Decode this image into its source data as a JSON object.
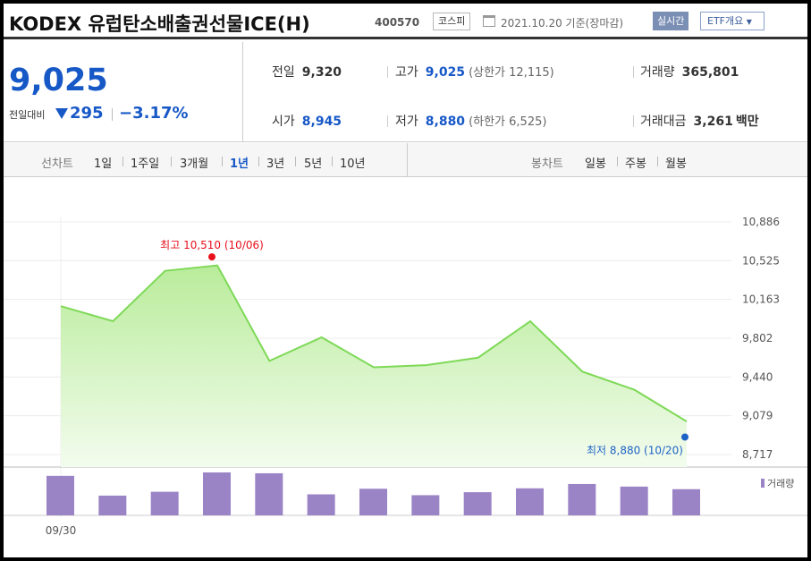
{
  "header": {
    "title": "KODEX 유럽탄소배출권선물ICE(H)",
    "code": "400570",
    "market": "코스피",
    "date": "2021.10.20",
    "date_suffix": "기준(장마감)",
    "realtime_label": "실시간",
    "etf_label": "ETF개요"
  },
  "quote": {
    "price": "9,025",
    "compare_label": "전일대비",
    "change": "295",
    "change_rate": "−3.17%",
    "prev_close": {
      "label": "전일",
      "value": "9,320"
    },
    "open": {
      "label": "시가",
      "value": "8,945"
    },
    "high": {
      "label": "고가",
      "value": "9,025",
      "sub": "(상한가 12,115)"
    },
    "low": {
      "label": "저가",
      "value": "8,880",
      "sub": "(하한가 6,525)"
    },
    "volume": {
      "label": "거래량",
      "value": "365,801"
    },
    "amount": {
      "label": "거래대금",
      "value": "3,261",
      "unit": "백만"
    }
  },
  "tabs": {
    "line_label": "선차트",
    "periods": [
      "1일",
      "1주일",
      "3개월",
      "1년",
      "3년",
      "5년",
      "10년"
    ],
    "selected_period": "1년",
    "candle_label": "봉차트",
    "candles": [
      "일봉",
      "주봉",
      "월봉"
    ]
  },
  "colors": {
    "line": "#7ed957",
    "area_top": "#b9ec9b",
    "area_bottom": "#f3fcee",
    "high_marker": "#e8101a",
    "low_marker": "#1e63c6",
    "volume_bar": "#9b84c6",
    "accent": "#1758c7"
  },
  "chart_data": {
    "type": "area",
    "x_label_first": "09/30",
    "price": [
      10100,
      9960,
      10430,
      10480,
      9590,
      9810,
      9530,
      9550,
      9620,
      9960,
      9490,
      9320,
      9025
    ],
    "volume_relative": [
      0.92,
      0.46,
      0.55,
      1.0,
      0.98,
      0.49,
      0.62,
      0.47,
      0.54,
      0.63,
      0.73,
      0.67,
      0.61
    ],
    "yticks": [
      "10,886",
      "10,525",
      "10,163",
      "9,802",
      "9,440",
      "9,079",
      "8,717"
    ],
    "ylim": [
      8717,
      10886
    ],
    "high_annotation": {
      "label": "최고 10,510 (10/06)",
      "value": 10510,
      "index": 3
    },
    "low_annotation": {
      "label": "최저 8,880 (10/20)",
      "value": 8880,
      "index": 12
    },
    "volume_legend": "거래량",
    "grid": true
  }
}
